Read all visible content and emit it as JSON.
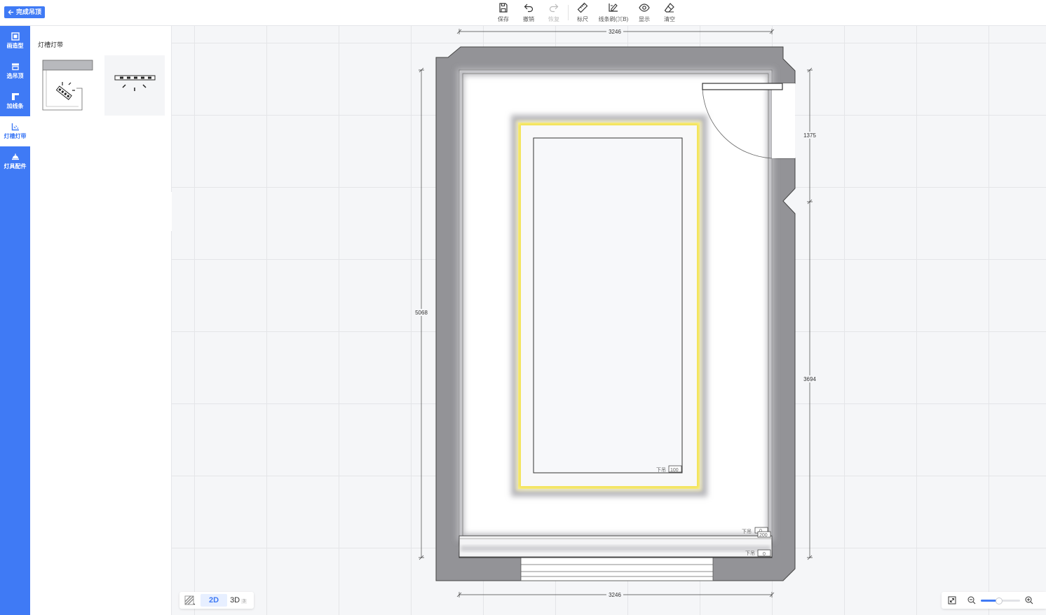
{
  "header": {
    "back_label": "完成吊顶",
    "tools": [
      {
        "label": "保存",
        "icon": "save-icon",
        "enabled": true
      },
      {
        "label": "撤销",
        "icon": "undo-icon",
        "enabled": true
      },
      {
        "label": "恢复",
        "icon": "redo-icon",
        "enabled": false
      },
      {
        "label": "标尺",
        "icon": "ruler-icon",
        "enabled": true
      },
      {
        "label": "线条刷(⌘B)",
        "icon": "line-brush-icon",
        "enabled": true
      },
      {
        "label": "显示",
        "icon": "eye-icon",
        "enabled": true
      },
      {
        "label": "清空",
        "icon": "eraser-icon",
        "enabled": true
      }
    ]
  },
  "sidebar": {
    "items": [
      {
        "label": "画造型",
        "icon": "draw-shape-icon",
        "active": false
      },
      {
        "label": "选吊顶",
        "icon": "select-ceiling-icon",
        "active": false
      },
      {
        "label": "加线条",
        "icon": "add-line-icon",
        "active": false
      },
      {
        "label": "灯槽灯带",
        "icon": "light-trough-icon",
        "active": true
      },
      {
        "label": "灯具配件",
        "icon": "lamp-fittings-icon",
        "active": false
      }
    ]
  },
  "panel": {
    "title": "灯槽灯带",
    "items": [
      {
        "name": "light-trough-option-1",
        "icon": "cove-light-section-icon"
      },
      {
        "name": "light-trough-option-2",
        "icon": "strip-light-icon"
      }
    ]
  },
  "plan": {
    "dims": {
      "top_width": "3246",
      "bottom_width": "3246",
      "left_height": "5068",
      "right_upper": "1375",
      "right_lower": "3694"
    },
    "tags": [
      {
        "label": "下吊",
        "value": "100"
      },
      {
        "label": "下吊",
        "value": "0"
      },
      {
        "label": "下吊",
        "value": "200"
      },
      {
        "label": "下吊",
        "value": "0"
      }
    ],
    "colors": {
      "wall": "#939397",
      "light_strip": "#f2e24f",
      "accent": "#3f7af5"
    }
  },
  "view_switch": {
    "texture_icon": "texture-icon",
    "mode_2d": "2D",
    "mode_3d": "3D",
    "badge_3d": "3"
  },
  "zoom": {
    "level": 0.45
  }
}
